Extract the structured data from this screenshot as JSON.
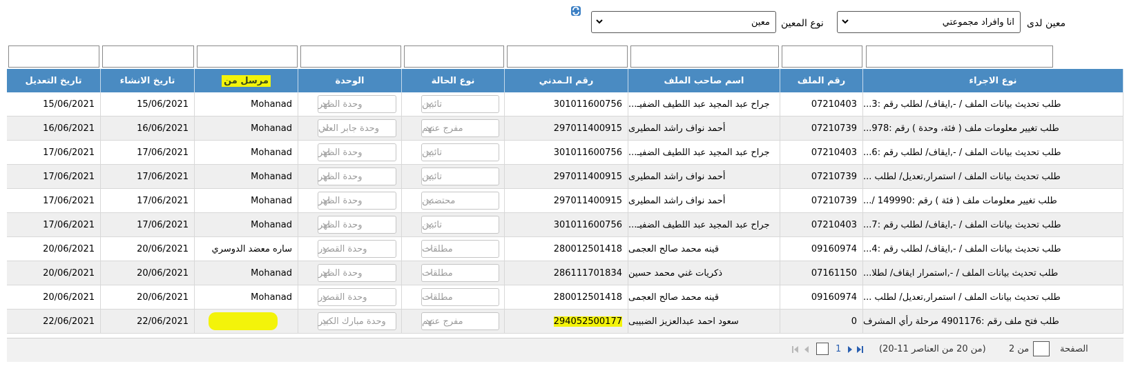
{
  "filters": {
    "assigned_by_label": "معين لدى",
    "assigned_by_value": "انا وافراد مجموعتي",
    "assignee_type_label": "نوع المعين",
    "assignee_type_value": "معين",
    "refresh_icon": "refresh-icon"
  },
  "columns": {
    "procedure_type": "نوع الاجراء",
    "file_number": "رقم الملف",
    "owner_name": "اسم صاحب الملف",
    "civil_id": "رقم الـمدني",
    "case_type": "نوع الحالة",
    "unit": "الوحدة",
    "sent_from": "مرسل من",
    "created_date": "تاريخ الانشاء",
    "modified_date": "تاريخ التعديل"
  },
  "rows": [
    {
      "procedure": "طلب تحديث بيانات الملف / -,ايقاف/ لطلب رقم :3...",
      "file": "07210403",
      "owner": "جراح عبد المجيد عبد اللطيف الضفيـ...",
      "civil": "301011600756",
      "case": "تائبين",
      "unit": "وحدة الظهر",
      "sender": "Mohanad",
      "created": "15/06/2021",
      "modified": "15/06/2021"
    },
    {
      "procedure": "طلب تغيير معلومات ملف ( فئة، وحدة ) رقم :978...",
      "file": "07210739",
      "owner": "أحمد نواف راشد المطيرى",
      "civil": "297011400915",
      "case": "مفرج عنهم",
      "unit": "وحدة جابر العلي",
      "sender": "Mohanad",
      "created": "16/06/2021",
      "modified": "16/06/2021"
    },
    {
      "procedure": "طلب تحديث بيانات الملف / -,ايقاف/ لطلب رقم :6...",
      "file": "07210403",
      "owner": "جراح عبد المجيد عبد اللطيف الضفيـ...",
      "civil": "301011600756",
      "case": "تائبين",
      "unit": "وحدة الظهر",
      "sender": "Mohanad",
      "created": "17/06/2021",
      "modified": "17/06/2021"
    },
    {
      "procedure": "طلب تحديث بيانات الملف / استمرار,تعديل/ لطلب ...",
      "file": "07210739",
      "owner": "أحمد نواف راشد المطيرى",
      "civil": "297011400915",
      "case": "تائبين",
      "unit": "وحدة الظهر",
      "sender": "Mohanad",
      "created": "17/06/2021",
      "modified": "17/06/2021"
    },
    {
      "procedure": "طلب تغيير معلومات ملف ( فئة ) رقم :149990 /...",
      "file": "07210739",
      "owner": "أحمد نواف راشد المطيرى",
      "civil": "297011400915",
      "case": "محتضنين",
      "unit": "وحدة الظهر",
      "sender": "Mohanad",
      "created": "17/06/2021",
      "modified": "17/06/2021"
    },
    {
      "procedure": "طلب تحديث بيانات الملف / -,ايقاف/ لطلب رقم :7...",
      "file": "07210403",
      "owner": "جراح عبد المجيد عبد اللطيف الضفيـ...",
      "civil": "301011600756",
      "case": "تائبين",
      "unit": "وحدة الظهر",
      "sender": "Mohanad",
      "created": "17/06/2021",
      "modified": "17/06/2021"
    },
    {
      "procedure": "طلب تحديث بيانات الملف / -,ايقاف/ لطلب رقم :4...",
      "file": "09160974",
      "owner": "قينه محمد صالح العجمى",
      "civil": "280012501418",
      "case": "مطلقات",
      "unit": "وحدة القصور",
      "sender": "ساره معضد الدوسري",
      "created": "20/06/2021",
      "modified": "20/06/2021"
    },
    {
      "procedure": "طلب تحديث بيانات الملف / -,استمرار ايقاف/ لطلا...",
      "file": "07161150",
      "owner": "ذكريات غني محمد حسين",
      "civil": "286111701834",
      "case": "مطلقات",
      "unit": "وحدة الظهر",
      "sender": "Mohanad",
      "created": "20/06/2021",
      "modified": "20/06/2021"
    },
    {
      "procedure": "طلب تحديث بيانات الملف / استمرار,تعديل/ لطلب ...",
      "file": "09160974",
      "owner": "قينه محمد صالح العجمى",
      "civil": "280012501418",
      "case": "مطلقات",
      "unit": "وحدة القصور",
      "sender": "Mohanad",
      "created": "20/06/2021",
      "modified": "20/06/2021"
    },
    {
      "procedure": "طلب فتح ملف رقم :4901176 مرحلة رأي المشرف",
      "file": "0",
      "owner": "سعود احمد عبدالعزيز الضبيبى",
      "civil": "294052500177",
      "case": "مفرج عنهم",
      "unit": "وحدة مبارك الكبير",
      "sender": "",
      "created": "22/06/2021",
      "modified": "22/06/2021"
    }
  ],
  "pager": {
    "page_label": "الصفحة",
    "page_of": "من 2",
    "items_info": "(20-11 من 20 من العناصر)",
    "page_1": "1"
  },
  "colors": {
    "header_bg": "#4a8bc2",
    "highlight": "#f3f30a",
    "alt_row": "#efefef"
  }
}
